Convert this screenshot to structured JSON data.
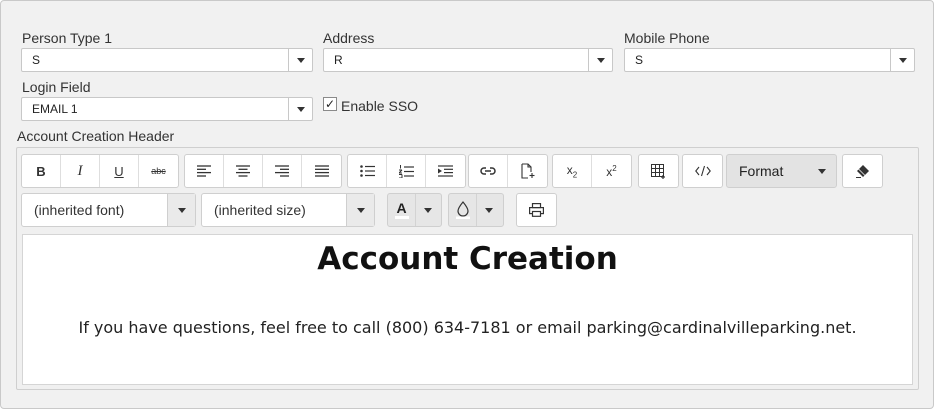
{
  "fields": {
    "person_type": {
      "label": "Person Type 1",
      "value": "S"
    },
    "address": {
      "label": "Address",
      "value": "R"
    },
    "mobile_phone": {
      "label": "Mobile Phone",
      "value": "S"
    },
    "login_field": {
      "label": "Login Field",
      "value": "EMAIL 1"
    },
    "enable_sso": {
      "label": "Enable SSO",
      "checked": true,
      "check_glyph": "✓"
    }
  },
  "editor": {
    "section_label": "Account Creation Header",
    "toolbar": {
      "format_label": "Format",
      "font_value": "(inherited font)",
      "size_value": "(inherited size)",
      "text_color_glyph": "A",
      "icons": [
        "bold-icon",
        "italic-icon",
        "underline-icon",
        "strikethrough-icon",
        "align-left-icon",
        "align-center-icon",
        "align-right-icon",
        "align-justify-icon",
        "bullet-list-icon",
        "numbered-list-icon",
        "indent-icon",
        "link-icon",
        "insert-file-icon",
        "subscript-icon",
        "superscript-icon",
        "table-icon",
        "code-view-icon",
        "clear-format-icon",
        "fill-color-icon",
        "print-icon"
      ],
      "bold_glyph": "B",
      "italic_glyph": "I",
      "underline_glyph": "U",
      "strike_glyph": "abc"
    },
    "content": {
      "heading": "Account Creation",
      "paragraph": "If you have questions, feel free to call (800) 634-7181 or email parking@cardinalvilleparking.net."
    }
  }
}
